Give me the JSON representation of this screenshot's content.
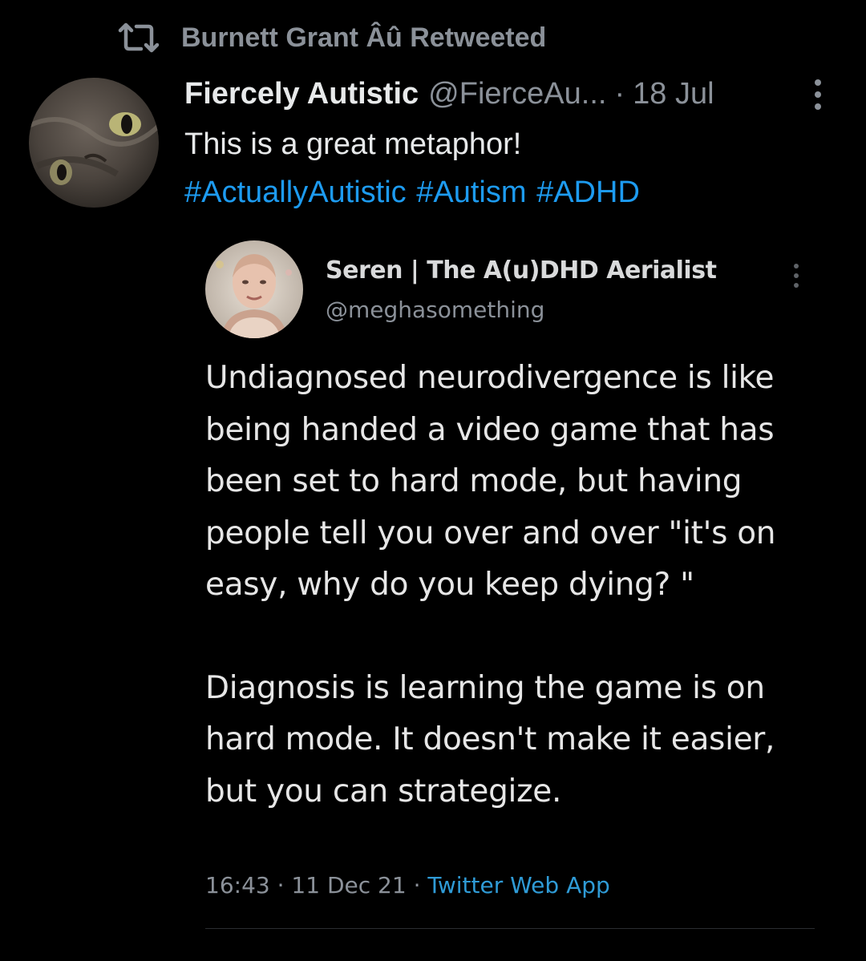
{
  "retweet": {
    "icon": "retweet-icon",
    "text": "Burnett Grant Âû Retweeted"
  },
  "tweet": {
    "author_name": "Fiercely Autistic",
    "author_handle": "@FierceAu...",
    "separator": "·",
    "date": "18 Jul",
    "more_icon": "more-vertical-icon",
    "text": "This is a great metaphor!",
    "hashtags": [
      "#ActuallyAutistic",
      "#Autism",
      "#ADHD"
    ]
  },
  "quoted": {
    "author_name": "Seren | The A(u)DHD Aerialist",
    "author_handle": "@meghasomething",
    "more_icon": "more-vertical-icon",
    "paragraphs": [
      "Undiagnosed neurodivergence is like being handed a video game that has been set to hard mode, but having people tell you over and over \"it's on easy, why do you keep dying? \"",
      "Diagnosis is learning the game is on hard mode. It doesn't make it easier, but you can strategize."
    ],
    "time": "16:43",
    "separator": "·",
    "date": "11 Dec 21",
    "source": "Twitter Web App"
  },
  "colors": {
    "background": "#000000",
    "text": "#e7e9ea",
    "muted": "#8b9199",
    "link": "#1d9bf0"
  }
}
